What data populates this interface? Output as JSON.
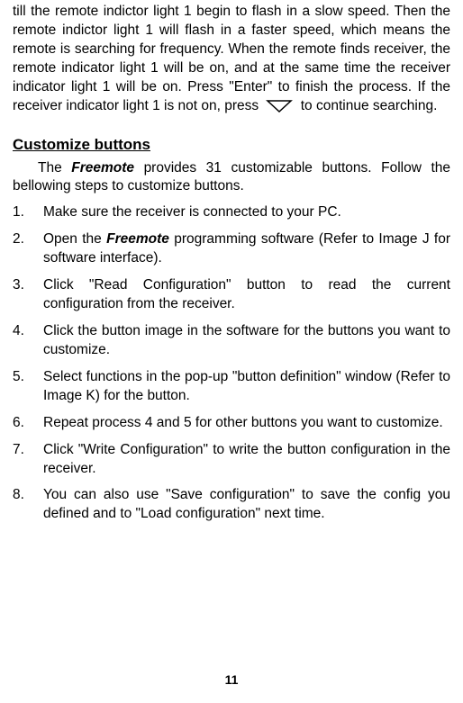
{
  "intro": {
    "text_before_icon": "till the remote indictor light 1 begin to flash in a slow speed. Then the remote indictor light 1 will flash in a faster speed, which means the remote is searching for frequency. When the remote finds receiver, the remote indicator light 1 will be on, and at the same time the receiver indicator light 1 will be on. Press \"Enter\" to finish the process. If the receiver indicator light 1 is not on, press ",
    "text_after_icon": " to continue searching."
  },
  "icons": {
    "down_triangle": "down-triangle-icon"
  },
  "section": {
    "heading": "Customize buttons",
    "intro_before_bold": "The ",
    "intro_bold": "Freemote",
    "intro_after_bold": " provides 31 customizable buttons. Follow the bellowing steps to customize buttons."
  },
  "steps": [
    {
      "num": "1.",
      "text_before": "Make sure the receiver is connected to your PC.",
      "bold": "",
      "text_after": ""
    },
    {
      "num": "2.",
      "text_before": "Open the ",
      "bold": "Freemote",
      "text_after": " programming software (Refer to Image J for software interface)."
    },
    {
      "num": "3.",
      "text_before": "Click \"Read Configuration\" button to read the current configuration from the receiver.",
      "bold": "",
      "text_after": ""
    },
    {
      "num": "4.",
      "text_before": "Click the button image in the software for the buttons you want to customize.",
      "bold": "",
      "text_after": ""
    },
    {
      "num": "5.",
      "text_before": "Select functions in the pop-up \"button definition\" window (Refer to Image K) for the button.",
      "bold": "",
      "text_after": ""
    },
    {
      "num": "6.",
      "text_before": "Repeat process 4 and 5 for other buttons you want to customize.",
      "bold": "",
      "text_after": ""
    },
    {
      "num": "7.",
      "text_before": "Click \"Write Configuration\" to write the button configuration in the receiver.",
      "bold": "",
      "text_after": ""
    },
    {
      "num": "8.",
      "text_before": "You can also use \"Save configuration\" to save the config you defined and to \"Load configuration\" next time.",
      "bold": "",
      "text_after": ""
    }
  ],
  "page_number": "11"
}
